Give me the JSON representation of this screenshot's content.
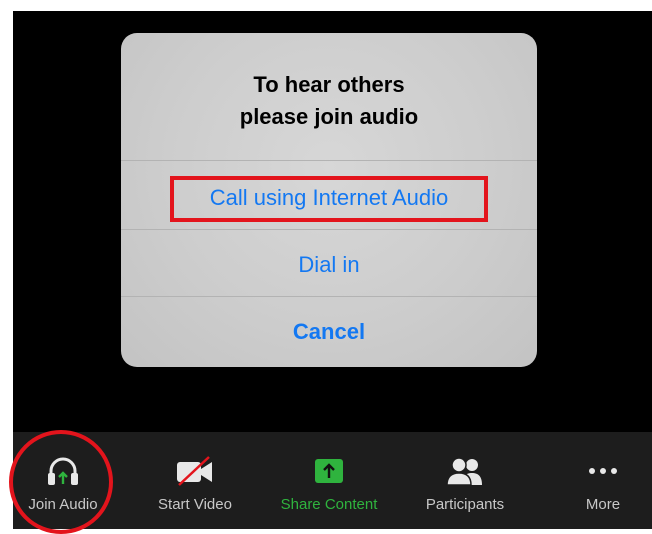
{
  "dialog": {
    "title_line1": "To hear others",
    "title_line2": "please join audio",
    "options": [
      {
        "label": "Call using Internet Audio"
      },
      {
        "label": "Dial in"
      },
      {
        "label": "Cancel"
      }
    ]
  },
  "toolbar": {
    "items": [
      {
        "label": "Join Audio",
        "icon": "headphones-icon"
      },
      {
        "label": "Start Video",
        "icon": "video-off-icon"
      },
      {
        "label": "Share Content",
        "icon": "share-up-arrow-icon"
      },
      {
        "label": "Participants",
        "icon": "participants-icon"
      },
      {
        "label": "More",
        "icon": "more-dots-icon"
      }
    ]
  },
  "colors": {
    "accent_blue": "#1378f2",
    "share_green": "#2fb33e",
    "annotation_red": "#e3141c",
    "toolbar_bg": "#1d1d1d"
  }
}
